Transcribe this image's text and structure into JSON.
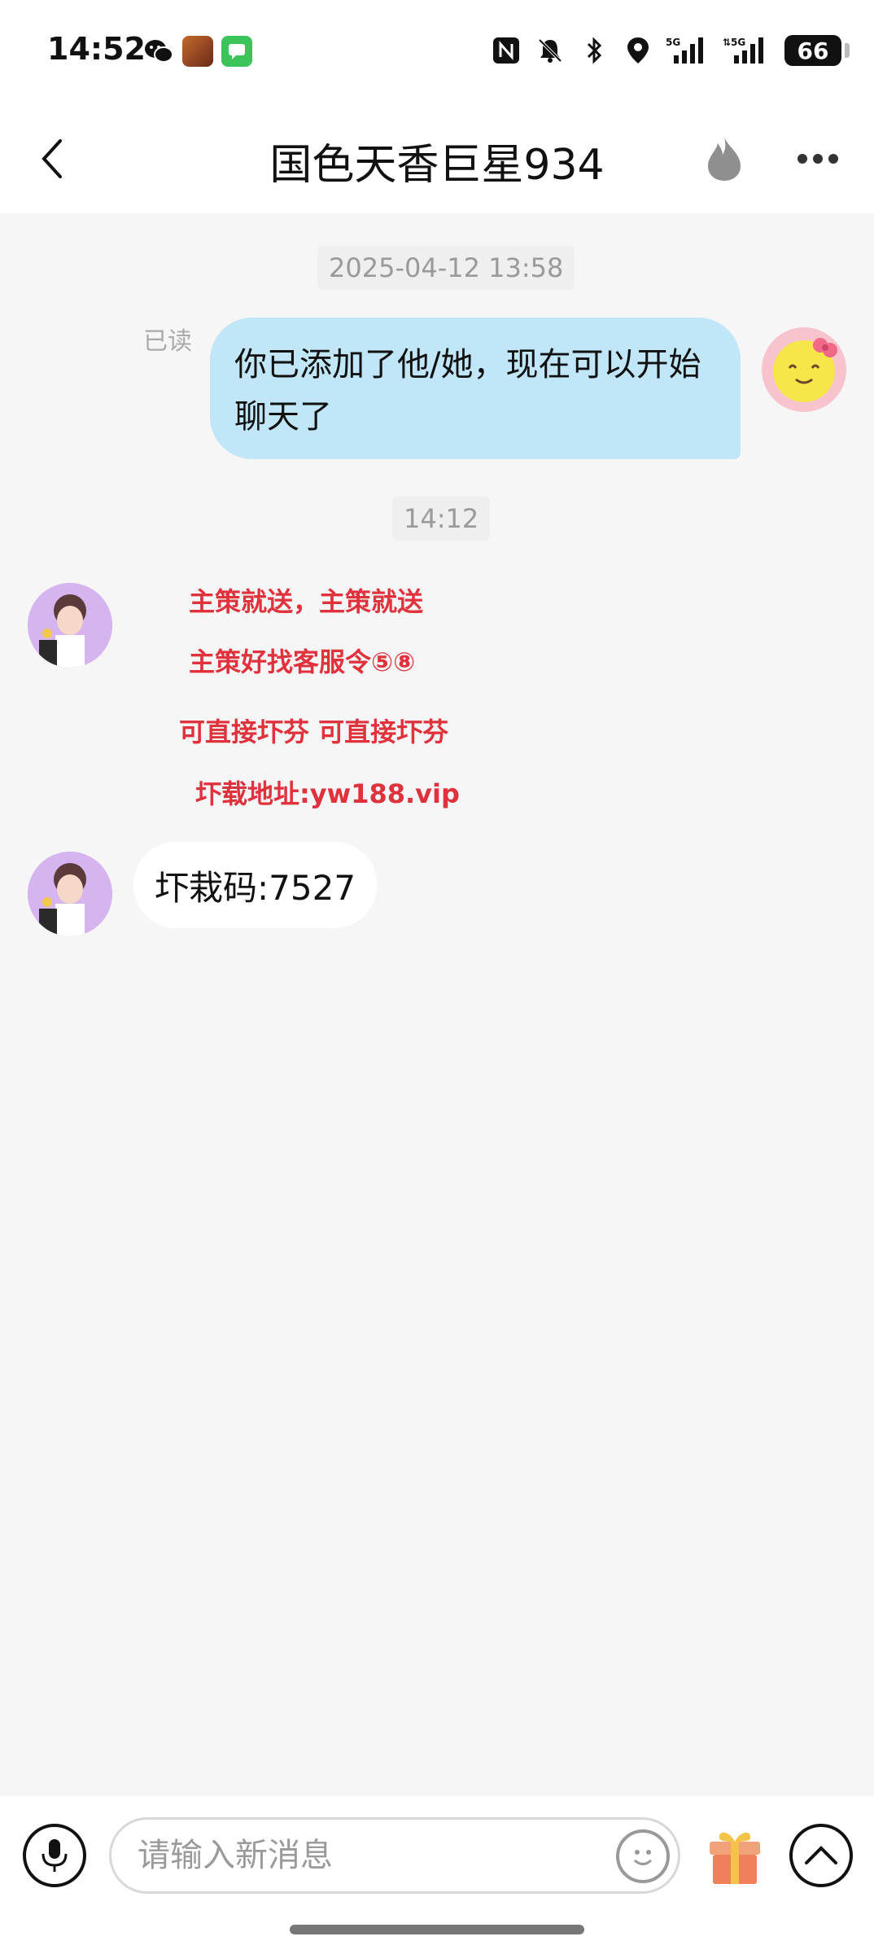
{
  "status_bar": {
    "time": "14:52",
    "battery": "66",
    "icons": [
      "wechat-icon",
      "game-app-icon",
      "messages-app-icon",
      "nfc-icon",
      "mute-bell-icon",
      "bluetooth-icon",
      "location-icon",
      "signal-5g-icon",
      "signal-5g-icon",
      "battery-icon"
    ]
  },
  "header": {
    "title": "国色天香巨星934",
    "back_icon": "chevron-left-icon",
    "flame_icon": "flame-icon",
    "more_icon": "more-dots-icon"
  },
  "chat": {
    "timestamp_1": "2025-04-12 13:58",
    "read_label": "已读",
    "outgoing_message": "你已添加了他/她，现在可以开始聊天了",
    "timestamp_2": "14:12",
    "incoming_lines": [
      "主策就送，主策就送",
      "主策好找客服令⑤⑧",
      "可直接圷芬 可直接圷芬",
      "圷载地址:yw188.vip"
    ],
    "incoming_message": "圷栽码:7527"
  },
  "input_bar": {
    "placeholder": "请输入新消息",
    "mic_icon": "microphone-icon",
    "emoji_icon": "smiley-icon",
    "gift_icon": "gift-icon",
    "expand_icon": "chevron-up-icon"
  },
  "colors": {
    "outgoing_bubble": "#c0e6f8",
    "promo_text": "#e0323c",
    "background": "#f6f6f6"
  }
}
